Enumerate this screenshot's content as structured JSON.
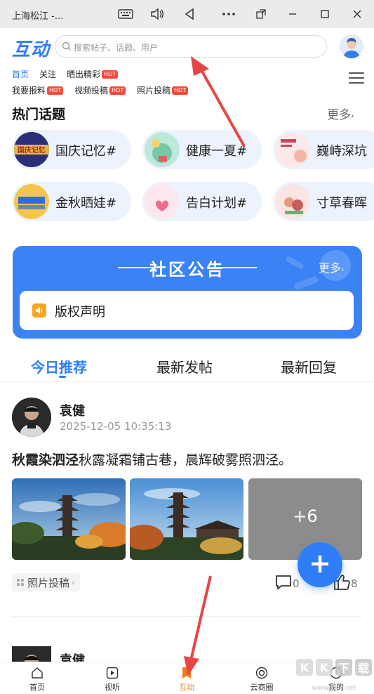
{
  "window": {
    "title": "上海松江 -...",
    "controls": [
      "keyboard-icon",
      "volume-icon",
      "back-icon",
      "more-icon",
      "screen-rotate-icon",
      "minimize-icon",
      "maximize-icon",
      "close-icon"
    ]
  },
  "header": {
    "logo": "互动",
    "search_placeholder": "搜索帖子、话题、用户"
  },
  "channels": {
    "row1": [
      {
        "label": "首页",
        "hot": false,
        "active": true
      },
      {
        "label": "关注",
        "hot": false,
        "active": false
      },
      {
        "label": "晒出精彩",
        "hot": true,
        "active": false
      }
    ],
    "row2": [
      {
        "label": "我要报料",
        "hot": true
      },
      {
        "label": "视频投稿",
        "hot": true
      },
      {
        "label": "照片投稿",
        "hot": true
      }
    ],
    "hot_badge": "HOT"
  },
  "hot_topics": {
    "title": "热门话题",
    "more": "更多",
    "items": [
      {
        "label": "国庆记忆#",
        "thumb_text": "国庆记忆"
      },
      {
        "label": "健康一夏#",
        "thumb_text": ""
      },
      {
        "label": "巍峙深坑",
        "thumb_text": ""
      },
      {
        "label": "金秋晒娃#",
        "thumb_text": ""
      },
      {
        "label": "告白计划#",
        "thumb_text": ""
      },
      {
        "label": "寸草春晖",
        "thumb_text": ""
      }
    ]
  },
  "notice": {
    "title": "社区公告",
    "more": "更多",
    "item": "版权声明"
  },
  "feed_tabs": [
    {
      "label": "今日推荐",
      "active": true
    },
    {
      "label": "最新发帖",
      "active": false
    },
    {
      "label": "最新回复",
      "active": false
    }
  ],
  "post": {
    "author": "袁健",
    "time": "2025-12-05 10:35:13",
    "title_bold": "秋霞染泗泾",
    "body": "秋露凝霜铺古巷，晨辉破雾照泗泾。",
    "extra_images": "+6",
    "tag": "照片投稿",
    "comments": "0",
    "likes": "8"
  },
  "post2": {
    "author": "袁健"
  },
  "fab": {
    "label": "+"
  },
  "bottom_nav": [
    {
      "label": "首页",
      "icon": "home-icon",
      "active": false
    },
    {
      "label": "视听",
      "icon": "play-icon",
      "active": false
    },
    {
      "label": "互动",
      "icon": "bookmark-icon",
      "active": true
    },
    {
      "label": "云商圈",
      "icon": "shop-icon",
      "active": false
    },
    {
      "label": "我的",
      "icon": "profile-icon",
      "active": false
    }
  ],
  "colors": {
    "accent": "#2f7ef7",
    "hot": "#f24a3c",
    "nav_active": "#f07a1a",
    "arrow": "#e84545"
  },
  "watermark": {
    "text": "KK下载",
    "url": "www.kkx.net"
  }
}
